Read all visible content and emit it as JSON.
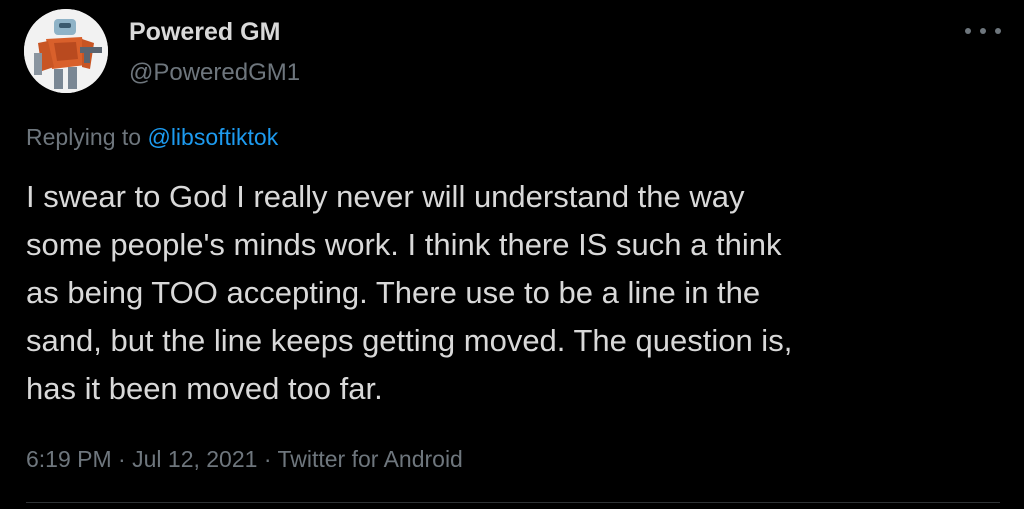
{
  "tweet": {
    "author": {
      "display_name": "Powered GM",
      "handle": "@PoweredGM1",
      "avatar_icon": "robot-avatar-icon"
    },
    "more_icon": "more-dots-icon",
    "replying": {
      "prefix": "Replying to",
      "mention": "@libsoftiktok"
    },
    "text": "I swear to God I really never will understand the way\nsome people's minds work. I think there IS such a think\nas being TOO accepting. There use to be a line in the\nsand, but the line keeps getting moved. The question is,\nhas it been moved too far.",
    "meta": {
      "time": "6:19 PM",
      "separator_1": "·",
      "date": "Jul 12, 2021",
      "separator_2": "·",
      "source": "Twitter for Android"
    }
  },
  "colors": {
    "background": "#000000",
    "text": "#d9d9d9",
    "secondary": "#6e767d",
    "link": "#1d9bf0",
    "divider": "#2f3336"
  }
}
